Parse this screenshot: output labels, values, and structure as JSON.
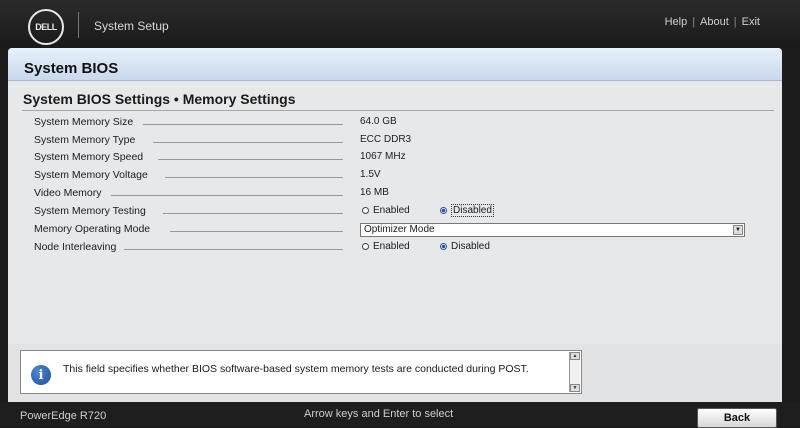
{
  "header": {
    "logo_text": "DELL",
    "title": "System Setup",
    "links": [
      "Help",
      "About",
      "Exit"
    ]
  },
  "panel": {
    "title": "System BIOS",
    "section_title": "System BIOS Settings • Memory Settings"
  },
  "settings": [
    {
      "label": "System Memory Size",
      "value": "64.0 GB"
    },
    {
      "label": "System Memory Type",
      "value": "ECC DDR3"
    },
    {
      "label": "System Memory Speed",
      "value": "1067 MHz"
    },
    {
      "label": "System Memory Voltage",
      "value": "1.5V"
    },
    {
      "label": "Video Memory",
      "value": "16 MB"
    },
    {
      "label": "System Memory Testing",
      "options": [
        "Enabled",
        "Disabled"
      ],
      "selected": "Disabled"
    },
    {
      "label": "Memory Operating Mode",
      "value": "Optimizer Mode"
    },
    {
      "label": "Node Interleaving",
      "options": [
        "Enabled",
        "Disabled"
      ],
      "selected": "Disabled"
    }
  ],
  "help": {
    "text": "This field specifies whether BIOS software-based system memory tests are conducted during POST."
  },
  "footer": {
    "model": "PowerEdge R720",
    "hint": "Arrow keys and Enter to select",
    "back_label": "Back"
  }
}
